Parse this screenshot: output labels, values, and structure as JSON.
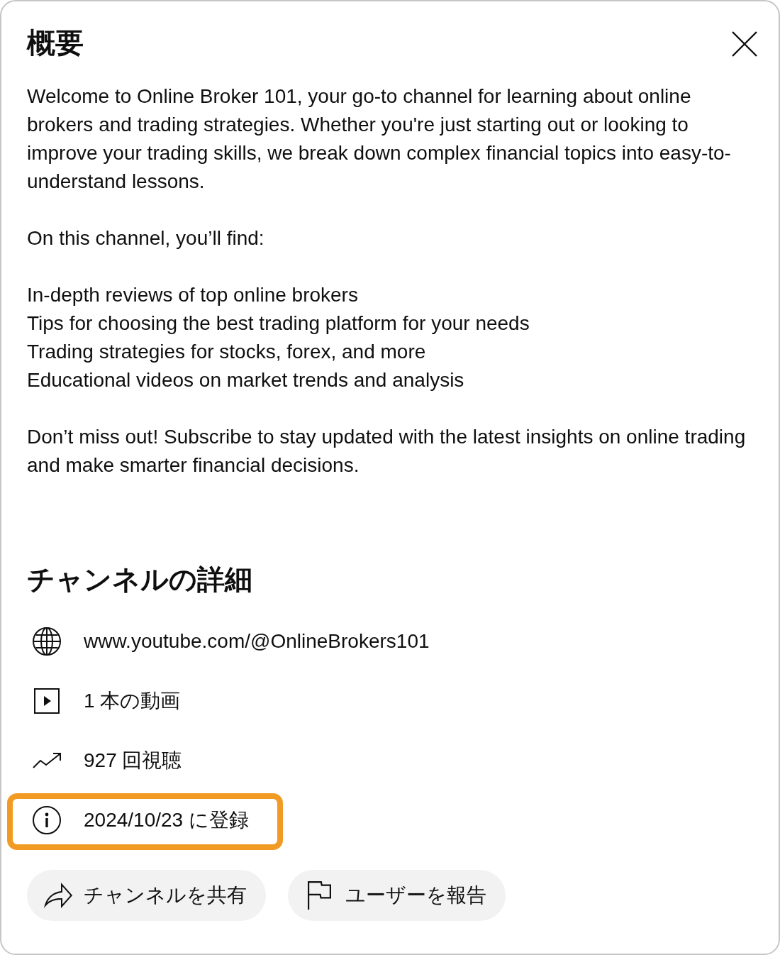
{
  "dialog": {
    "title": "概要"
  },
  "description": [
    {
      "kind": "paragraph",
      "text": "Welcome to Online Broker 101, your go-to channel for learning about online brokers and trading strategies. Whether you're just starting out or looking to improve your trading skills, we break down complex financial topics into easy-to-understand lessons."
    },
    {
      "kind": "paragraph",
      "text": "On this channel, you’ll find:"
    },
    {
      "kind": "lines",
      "items": [
        "In-depth reviews of top online brokers",
        "Tips for choosing the best trading platform for your needs",
        "Trading strategies for stocks, forex, and more",
        "Educational videos on market trends and analysis"
      ]
    },
    {
      "kind": "paragraph",
      "text": "Don’t miss out! Subscribe to stay updated with the latest insights on online trading and make smarter financial decisions."
    }
  ],
  "details": {
    "title": "チャンネルの詳細",
    "items": [
      {
        "kind": "link",
        "text": "www.youtube.com/@OnlineBrokers101",
        "highlighted": false
      },
      {
        "kind": "videos",
        "text": "1 本の動画",
        "highlighted": false
      },
      {
        "kind": "views",
        "text": "927 回視聴",
        "highlighted": false
      },
      {
        "kind": "joined",
        "text": "2024/10/23 に登録",
        "highlighted": true
      }
    ]
  },
  "actions": [
    {
      "kind": "share",
      "label": "チャンネルを共有"
    },
    {
      "kind": "report",
      "label": "ユーザーを報告"
    }
  ]
}
